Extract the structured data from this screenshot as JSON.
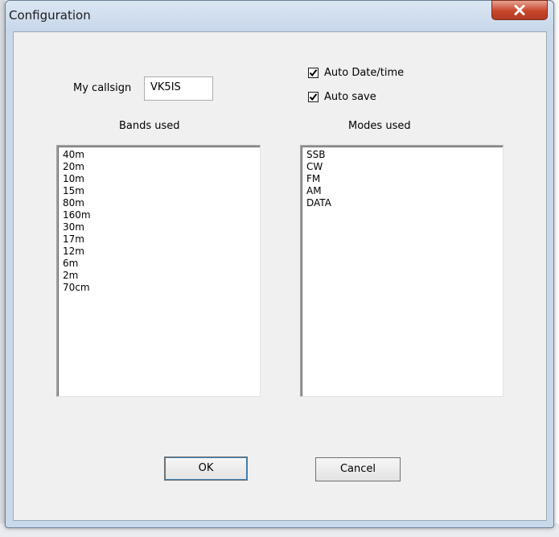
{
  "window": {
    "title": "Configuration"
  },
  "callsign": {
    "label": "My callsign",
    "value": "VK5IS"
  },
  "options": [
    {
      "label": "Auto Date/time",
      "checked": true
    },
    {
      "label": "Auto save",
      "checked": true
    }
  ],
  "bands": {
    "heading": "Bands used",
    "items": [
      "40m",
      "20m",
      "10m",
      "15m",
      "80m",
      "160m",
      "30m",
      "17m",
      "12m",
      "6m",
      "2m",
      "70cm"
    ]
  },
  "modes": {
    "heading": "Modes used",
    "items": [
      "SSB",
      "CW",
      "FM",
      "AM",
      "DATA"
    ]
  },
  "buttons": {
    "ok": "OK",
    "cancel": "Cancel"
  },
  "colors": {
    "close_button": "#c7462c",
    "frame": "#c9d9ec",
    "client": "#f0f0f0"
  }
}
